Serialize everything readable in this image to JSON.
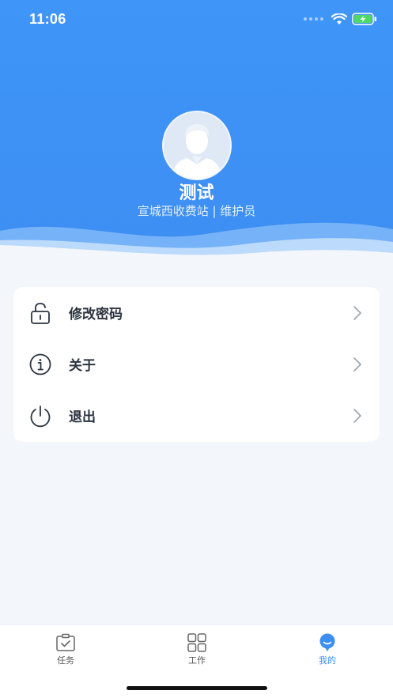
{
  "status_bar": {
    "time": "11:06",
    "battery_icon": "battery-charging-icon",
    "wifi_icon": "wifi-icon"
  },
  "profile": {
    "name": "测试",
    "subtitle": "宣城西收费站 | 维护员",
    "avatar_icon": "user-avatar-icon"
  },
  "menu": {
    "items": [
      {
        "label": "修改密码",
        "icon": "unlock-icon"
      },
      {
        "label": "关于",
        "icon": "info-icon"
      },
      {
        "label": "退出",
        "icon": "power-icon"
      }
    ]
  },
  "tabbar": {
    "tabs": [
      {
        "label": "任务",
        "icon": "clipboard-check-icon",
        "active": false
      },
      {
        "label": "工作",
        "icon": "grid-icon",
        "active": false
      },
      {
        "label": "我的",
        "icon": "user-bubble-icon",
        "active": true
      }
    ]
  },
  "colors": {
    "primary": "#3d8ef2",
    "background": "#f3f6fa",
    "text": "#2b3440"
  }
}
